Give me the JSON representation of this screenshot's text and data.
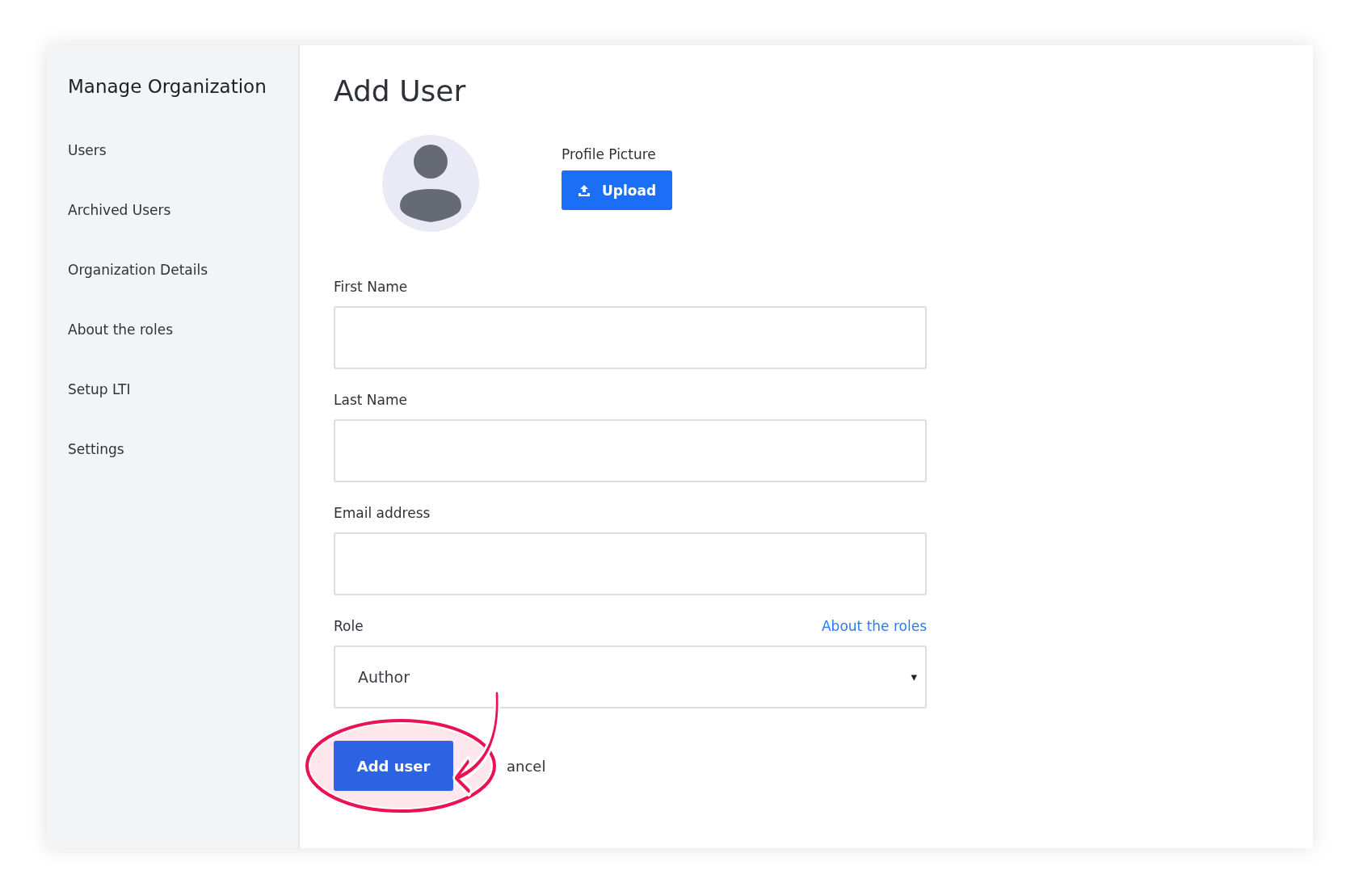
{
  "sidebar": {
    "title": "Manage Organization",
    "items": [
      {
        "label": "Users",
        "selected": false
      },
      {
        "label": "Archived Users",
        "selected": false
      },
      {
        "label": "Organization Details",
        "selected": false
      },
      {
        "label": "About the roles",
        "selected": false
      },
      {
        "label": "Setup LTI",
        "selected": false
      },
      {
        "label": "Settings",
        "selected": false
      }
    ]
  },
  "main": {
    "title": "Add User",
    "profile_picture": {
      "label": "Profile Picture",
      "button": "Upload"
    },
    "fields": [
      {
        "label": "First Name"
      },
      {
        "label": "Last Name"
      },
      {
        "label": "Email address"
      }
    ],
    "role": {
      "label": "Role",
      "link": "About the roles",
      "value": "Author",
      "caret": "▾"
    },
    "buttons": {
      "primary": "Add user",
      "secondary": "ancel"
    }
  }
}
